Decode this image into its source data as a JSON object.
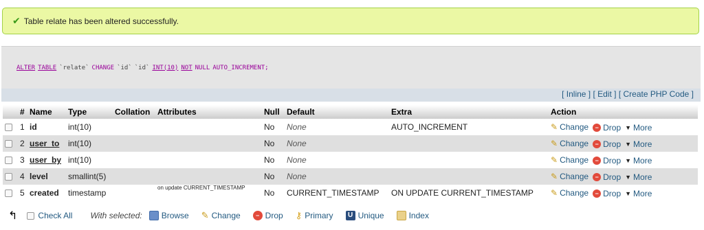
{
  "notice": {
    "message": "Table relate has been altered successfully."
  },
  "sql": {
    "tokens": [
      {
        "t": "ALTER",
        "c": "kw"
      },
      {
        "t": "TABLE",
        "c": "kw"
      },
      {
        "t": "`relate`",
        "c": "sym"
      },
      {
        "t": "CHANGE",
        "c": "kw2"
      },
      {
        "t": "`id`",
        "c": "sym"
      },
      {
        "t": "`id`",
        "c": "sym"
      },
      {
        "t": "INT(10)",
        "c": "fn"
      },
      {
        "t": "NOT",
        "c": "kw"
      },
      {
        "t": "NULL",
        "c": "kw2"
      },
      {
        "t": "AUTO_INCREMENT;",
        "c": "kw2"
      }
    ],
    "links": {
      "inline": "Inline",
      "edit": "Edit",
      "create_php": "Create PHP Code"
    }
  },
  "table": {
    "headers": [
      "",
      "#",
      "Name",
      "Type",
      "Collation",
      "Attributes",
      "Null",
      "Default",
      "Extra",
      "Action"
    ],
    "rows": [
      {
        "num": "1",
        "name": "id",
        "linked": false,
        "type": "int(10)",
        "collation": "",
        "attributes": "",
        "null": "No",
        "default": "None",
        "default_italic": true,
        "extra": "AUTO_INCREMENT"
      },
      {
        "num": "2",
        "name": "user_to",
        "linked": true,
        "type": "int(10)",
        "collation": "",
        "attributes": "",
        "null": "No",
        "default": "None",
        "default_italic": true,
        "extra": ""
      },
      {
        "num": "3",
        "name": "user_by",
        "linked": true,
        "type": "int(10)",
        "collation": "",
        "attributes": "",
        "null": "No",
        "default": "None",
        "default_italic": true,
        "extra": ""
      },
      {
        "num": "4",
        "name": "level",
        "linked": false,
        "type": "smallint(5)",
        "collation": "",
        "attributes": "",
        "null": "No",
        "default": "None",
        "default_italic": true,
        "extra": ""
      },
      {
        "num": "5",
        "name": "created",
        "linked": false,
        "type": "timestamp",
        "collation": "",
        "attributes": "on update CURRENT_TIMESTAMP",
        "null": "No",
        "default": "CURRENT_TIMESTAMP",
        "default_italic": false,
        "extra": "ON UPDATE CURRENT_TIMESTAMP"
      }
    ],
    "actions": {
      "change": "Change",
      "drop": "Drop",
      "more": "More"
    }
  },
  "bottom_bar": {
    "check_all": "Check All",
    "with_selected": "With selected:",
    "browse": "Browse",
    "change": "Change",
    "drop": "Drop",
    "primary": "Primary",
    "unique": "Unique",
    "index": "Index"
  }
}
